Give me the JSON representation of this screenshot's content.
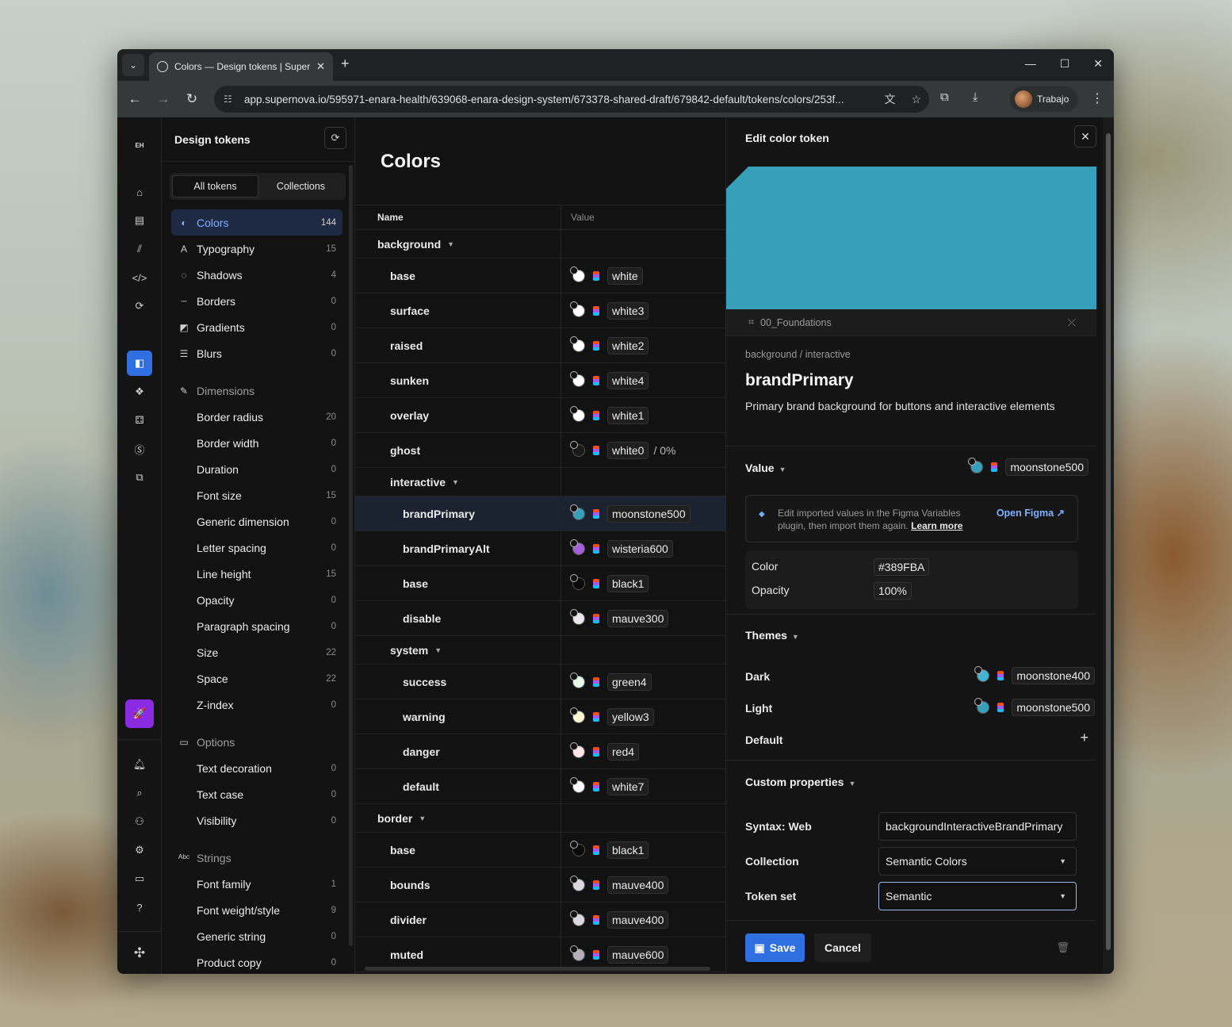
{
  "browser": {
    "tab_title": "Colors — Design tokens | Supernova",
    "url": "app.supernova.io/595971-enara-health/639068-enara-design-system/673378-shared-draft/679842-default/tokens/colors/253f...",
    "profile": "Trabajo"
  },
  "rail": {
    "org": "EH"
  },
  "sidebar": {
    "title": "Design tokens",
    "seg": [
      "All tokens",
      "Collections"
    ],
    "items": [
      {
        "label": "Colors",
        "count": "144",
        "icon": "palette-icon",
        "sel": true
      },
      {
        "label": "Typography",
        "count": "15",
        "icon": "typography-icon"
      },
      {
        "label": "Shadows",
        "count": "4",
        "icon": "shadow-icon"
      },
      {
        "label": "Borders",
        "count": "0",
        "icon": "border-icon"
      },
      {
        "label": "Gradients",
        "count": "0",
        "icon": "gradient-icon"
      },
      {
        "label": "Blurs",
        "count": "0",
        "icon": "blur-icon"
      },
      {
        "label": "Dimensions",
        "count": "",
        "icon": "ruler-icon",
        "group": true
      },
      {
        "label": "Border radius",
        "count": "20",
        "sub": true
      },
      {
        "label": "Border width",
        "count": "0",
        "sub": true
      },
      {
        "label": "Duration",
        "count": "0",
        "sub": true
      },
      {
        "label": "Font size",
        "count": "15",
        "sub": true
      },
      {
        "label": "Generic dimension",
        "count": "0",
        "sub": true
      },
      {
        "label": "Letter spacing",
        "count": "0",
        "sub": true
      },
      {
        "label": "Line height",
        "count": "15",
        "sub": true
      },
      {
        "label": "Opacity",
        "count": "0",
        "sub": true
      },
      {
        "label": "Paragraph spacing",
        "count": "0",
        "sub": true
      },
      {
        "label": "Size",
        "count": "22",
        "sub": true
      },
      {
        "label": "Space",
        "count": "22",
        "sub": true
      },
      {
        "label": "Z-index",
        "count": "0",
        "sub": true
      },
      {
        "label": "Options",
        "count": "",
        "icon": "options-icon",
        "group": true
      },
      {
        "label": "Text decoration",
        "count": "0",
        "sub": true
      },
      {
        "label": "Text case",
        "count": "0",
        "sub": true
      },
      {
        "label": "Visibility",
        "count": "0",
        "sub": true
      },
      {
        "label": "Strings",
        "count": "",
        "icon": "string-icon",
        "group": true
      },
      {
        "label": "Font family",
        "count": "1",
        "sub": true
      },
      {
        "label": "Font weight/style",
        "count": "9",
        "sub": true
      },
      {
        "label": "Generic string",
        "count": "0",
        "sub": true
      },
      {
        "label": "Product copy",
        "count": "0",
        "sub": true
      }
    ]
  },
  "table": {
    "title": "Colors",
    "col_name": "Name",
    "col_value": "Value",
    "rows": [
      {
        "name": "background",
        "level": 0,
        "group": true
      },
      {
        "name": "base",
        "level": 1,
        "value": "white",
        "color": "#ffffff"
      },
      {
        "name": "surface",
        "level": 1,
        "value": "white3",
        "color": "#ffffff"
      },
      {
        "name": "raised",
        "level": 1,
        "value": "white2",
        "color": "#ffffff"
      },
      {
        "name": "sunken",
        "level": 1,
        "value": "white4",
        "color": "#ffffff"
      },
      {
        "name": "overlay",
        "level": 1,
        "value": "white1",
        "color": "#ffffff"
      },
      {
        "name": "ghost",
        "level": 1,
        "value": "white0",
        "color": "#1a1a1a",
        "pct": "0%"
      },
      {
        "name": "interactive",
        "level": 1,
        "group": true
      },
      {
        "name": "brandPrimary",
        "level": 2,
        "value": "moonstone500",
        "color": "#389FBA",
        "sel": true
      },
      {
        "name": "brandPrimaryAlt",
        "level": 2,
        "value": "wisteria600",
        "color": "#a35fd6"
      },
      {
        "name": "base",
        "level": 2,
        "value": "black1",
        "color": "#0a0a0a"
      },
      {
        "name": "disable",
        "level": 2,
        "value": "mauve300",
        "color": "#e9e6ec"
      },
      {
        "name": "system",
        "level": 1,
        "group": true
      },
      {
        "name": "success",
        "level": 2,
        "value": "green4",
        "color": "#e6f7ea"
      },
      {
        "name": "warning",
        "level": 2,
        "value": "yellow3",
        "color": "#fff7d1"
      },
      {
        "name": "danger",
        "level": 2,
        "value": "red4",
        "color": "#fde4e6"
      },
      {
        "name": "default",
        "level": 2,
        "value": "white7",
        "color": "#ffffff"
      },
      {
        "name": "border",
        "level": 0,
        "group": true
      },
      {
        "name": "base",
        "level": 1,
        "value": "black1",
        "color": "#0a0a0a"
      },
      {
        "name": "bounds",
        "level": 1,
        "value": "mauve400",
        "color": "#dcd8e0"
      },
      {
        "name": "divider",
        "level": 1,
        "value": "mauve400",
        "color": "#dcd8e0"
      },
      {
        "name": "muted",
        "level": 1,
        "value": "mauve600",
        "color": "#b4afb9"
      }
    ]
  },
  "panel": {
    "title": "Edit color token",
    "preview_color": "#389FBA",
    "source": "00_Foundations",
    "path": "background / interactive",
    "name": "brandPrimary",
    "description": "Primary brand background for buttons and interactive elements",
    "value_label": "Value",
    "value": "moonstone500",
    "info_text": "Edit imported values in the Figma Variables plugin, then import them again.",
    "info_link": "Learn more",
    "open_figma": "Open Figma ↗",
    "color_label": "Color",
    "color_hex": "#389FBA",
    "opacity_label": "Opacity",
    "opacity": "100%",
    "themes_label": "Themes",
    "themes": [
      {
        "name": "Dark",
        "value": "moonstone400",
        "color": "#45b3cf"
      },
      {
        "name": "Light",
        "value": "moonstone500",
        "color": "#389FBA"
      }
    ],
    "default_label": "Default",
    "custom_label": "Custom properties",
    "syntax_label": "Syntax: Web",
    "syntax_value": "backgroundInteractiveBrandPrimary",
    "collection_label": "Collection",
    "collection_value": "Semantic Colors",
    "tokenset_label": "Token set",
    "tokenset_value": "Semantic",
    "save": "Save",
    "cancel": "Cancel"
  }
}
